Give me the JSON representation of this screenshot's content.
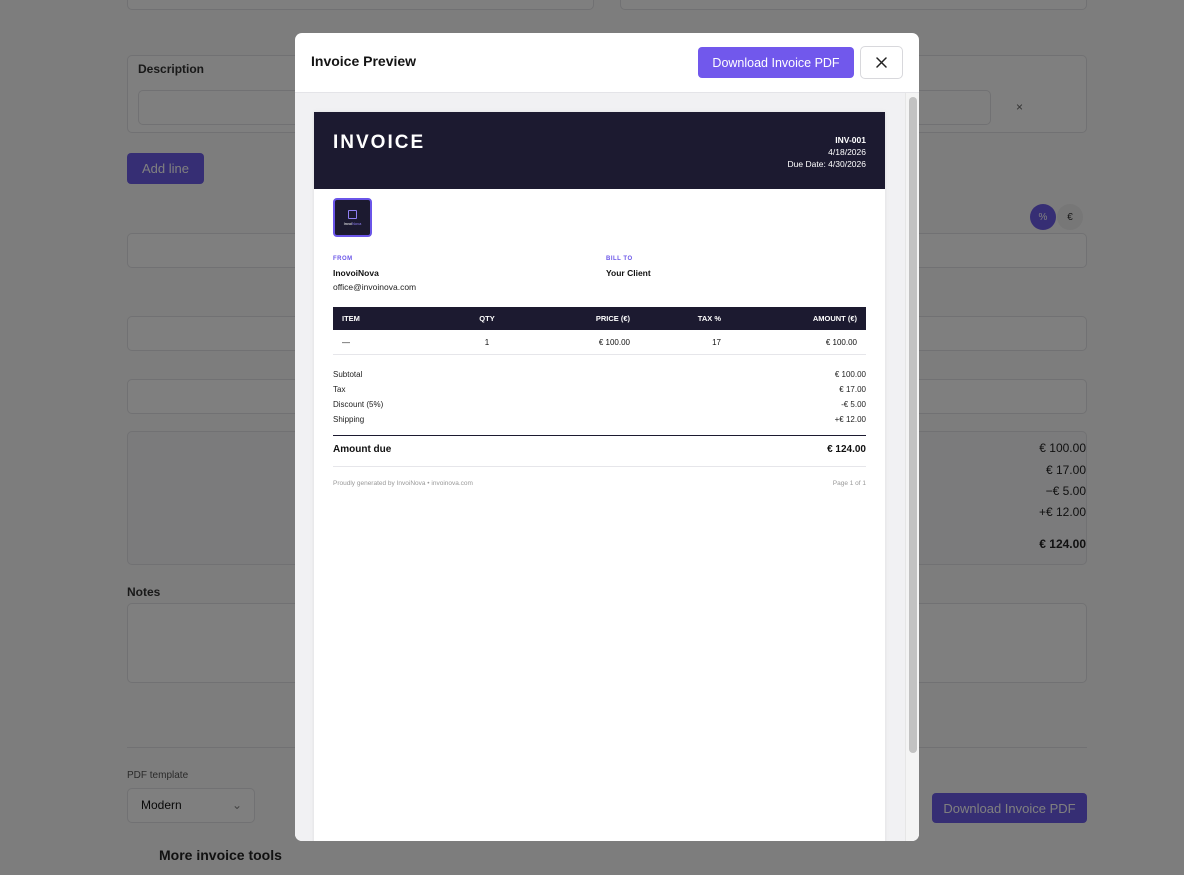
{
  "background": {
    "description_label": "Description",
    "add_line_label": "Add line",
    "remove_icon": "×",
    "toggle_percent": "%",
    "toggle_euro": "€",
    "totals": [
      "€ 100.00",
      "€ 17.00",
      "−€ 5.00",
      "+€ 12.00",
      "€ 124.00"
    ],
    "notes_label": "Notes",
    "pdf_template_label": "PDF template",
    "pdf_template_value": "Modern",
    "download_label": "Download Invoice PDF",
    "more_tools_label": "More invoice tools"
  },
  "modal": {
    "title": "Invoice Preview",
    "download_label": "Download Invoice PDF",
    "close_icon": "close-icon"
  },
  "invoice": {
    "heading": "INVOICE",
    "number": "INV-001",
    "date": "4/18/2026",
    "due_date": "Due Date: 4/30/2026",
    "logo_text_a": "Invoi",
    "logo_text_b": "Nova",
    "from_label": "FROM",
    "from_name": "InovoiNova",
    "from_email": "office@invoinova.com",
    "bill_to_label": "BILL TO",
    "bill_to_name": "Your Client",
    "columns": {
      "item": "ITEM",
      "qty": "QTY",
      "price": "PRICE (€)",
      "tax": "TAX %",
      "amount": "AMOUNT (€)"
    },
    "rows": [
      {
        "item": "—",
        "qty": "1",
        "price": "€ 100.00",
        "tax": "17",
        "amount": "€ 100.00"
      }
    ],
    "totals": [
      {
        "label": "Subtotal",
        "value": "€ 100.00"
      },
      {
        "label": "Tax",
        "value": "€ 17.00"
      },
      {
        "label": "Discount (5%)",
        "value": "-€ 5.00"
      },
      {
        "label": "Shipping",
        "value": "+€ 12.00"
      }
    ],
    "amount_due_label": "Amount due",
    "amount_due_value": "€ 124.00",
    "footer_left": "Proudly generated by InvoiNova • invoinova.com",
    "footer_right": "Page 1 of 1"
  },
  "colors": {
    "accent": "#7158ec",
    "header_dark": "#1c1a30",
    "overlay": "rgba(0,0,0,0.5)"
  }
}
